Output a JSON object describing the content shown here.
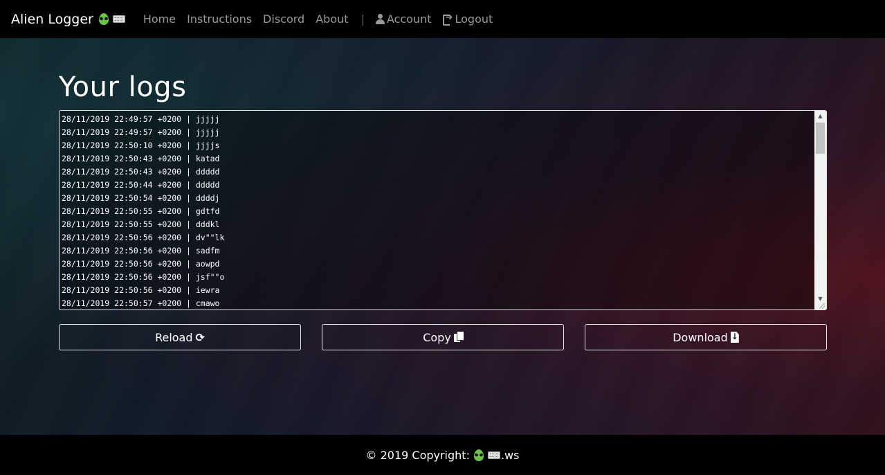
{
  "navbar": {
    "brand": "Alien Logger",
    "links": [
      "Home",
      "Instructions",
      "Discord",
      "About"
    ],
    "separator": "|",
    "account_label": "Account",
    "logout_label": "Logout"
  },
  "main": {
    "title": "Your logs",
    "log_lines": [
      "28/11/2019 22:49:57 +0200 | jjjjj",
      "28/11/2019 22:49:57 +0200 | jjjjj",
      "28/11/2019 22:50:10 +0200 | jjjjs",
      "28/11/2019 22:50:43 +0200 | katad",
      "28/11/2019 22:50:43 +0200 | ddddd",
      "28/11/2019 22:50:44 +0200 | ddddd",
      "28/11/2019 22:50:54 +0200 | ddddj",
      "28/11/2019 22:50:55 +0200 | gdtfd",
      "28/11/2019 22:50:55 +0200 | dddkl",
      "28/11/2019 22:50:56 +0200 | dv\"\"lk",
      "28/11/2019 22:50:56 +0200 | sadfm",
      "28/11/2019 22:50:56 +0200 | aowpd",
      "28/11/2019 22:50:56 +0200 | jsf\"\"o",
      "28/11/2019 22:50:56 +0200 | iewra",
      "28/11/2019 22:50:57 +0200 | cmawo"
    ],
    "buttons": {
      "reload": "Reload",
      "copy": "Copy",
      "download": "Download"
    }
  },
  "footer": {
    "copyright": "© 2019 Copyright:",
    "domain_suffix": ".ws"
  },
  "icons": {
    "brand": [
      "alien-emoji",
      "keyboard-emoji"
    ],
    "account": "user-icon",
    "logout": "sign-out-icon",
    "reload": "refresh-icon",
    "copy": "copy-files-icon",
    "download": "file-download-icon"
  }
}
